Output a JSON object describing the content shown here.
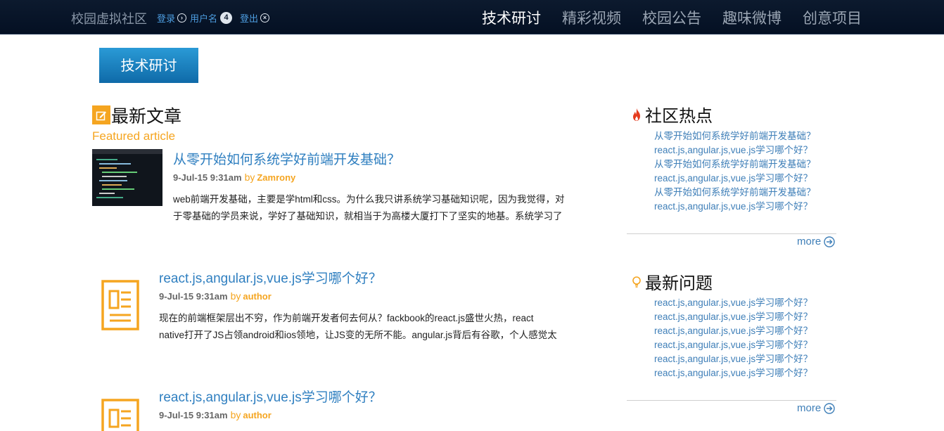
{
  "header": {
    "site_name": "校园虚拟社区",
    "login": "登录",
    "username": "用户名",
    "badge_count": "4",
    "logout": "登出",
    "nav": [
      "技术研讨",
      "精彩视频",
      "校园公告",
      "趣味微博",
      "创意项目"
    ]
  },
  "section_button": "技术研讨",
  "latest": {
    "title": "最新文章",
    "subtitle": "Featured article"
  },
  "articles": [
    {
      "title": "从零开始如何系统学好前端开发基础？",
      "date": "9-Jul-15 9:31am",
      "by": "by",
      "author": "Zamrony",
      "line1": "web前端开发基础，主要是学html和css。为什么我只讲系统学习基础知识呢，因为我觉得，对",
      "line2": "于零基础的学员来说，学好了基础知识，就相当于为高楼大厦打下了坚实的地基。系统学习了"
    },
    {
      "title": "react.js,angular.js,vue.js学习哪个好？",
      "date": "9-Jul-15 9:31am",
      "by": "by",
      "author": "author",
      "line1": "现在的前端框架层出不穷，作为前端开发者何去何从？fackbook的react.js盛世火热，react",
      "line2": "native打开了JS占领android和ios领地，让JS变的无所不能。angular.js背后有谷歌，个人感觉太"
    },
    {
      "title": "react.js,angular.js,vue.js学习哪个好？",
      "date": "9-Jul-15 9:31am",
      "by": "by",
      "author": "author"
    }
  ],
  "hot": {
    "title": "社区热点",
    "items": [
      "从零开始如何系统学好前端开发基础？",
      "react.js,angular.js,vue.js学习哪个好？",
      "从零开始如何系统学好前端开发基础？",
      "react.js,angular.js,vue.js学习哪个好？",
      "从零开始如何系统学好前端开发基础？",
      "react.js,angular.js,vue.js学习哪个好？"
    ],
    "more": "more"
  },
  "questions": {
    "title": "最新问题",
    "items": [
      "react.js,angular.js,vue.js学习哪个好？",
      "react.js,angular.js,vue.js学习哪个好？",
      "react.js,angular.js,vue.js学习哪个好？",
      "react.js,angular.js,vue.js学习哪个好？",
      "react.js,angular.js,vue.js学习哪个好？",
      "react.js,angular.js,vue.js学习哪个好？"
    ],
    "more": "more"
  },
  "colors": {
    "accent_orange": "#f5a520",
    "link_blue": "#2f7fc0",
    "header_bg": "#0c1a2e"
  }
}
